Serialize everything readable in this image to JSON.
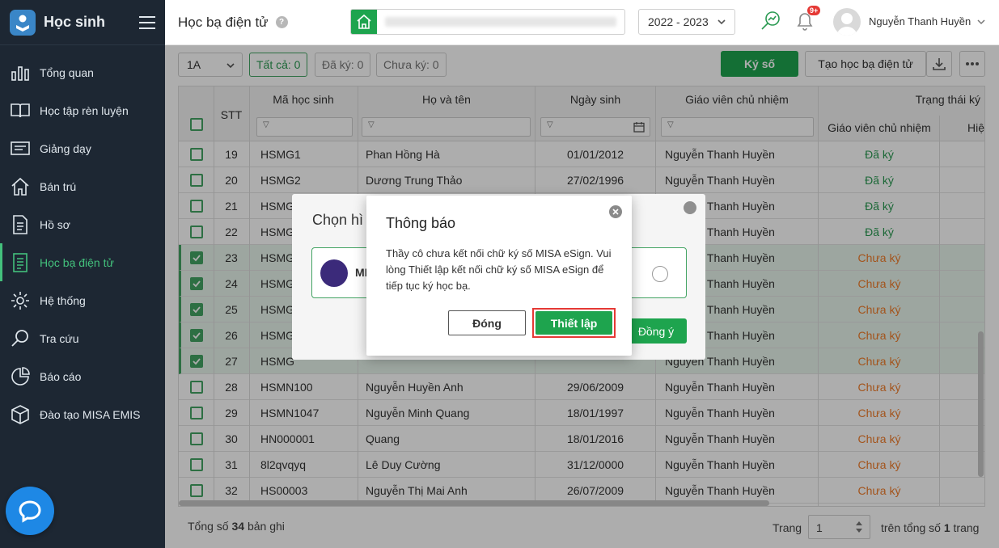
{
  "sidebar": {
    "title": "Học sinh",
    "items": [
      {
        "label": "Tổng quan"
      },
      {
        "label": "Học tập rèn luyện"
      },
      {
        "label": "Giảng dạy"
      },
      {
        "label": "Bán trú"
      },
      {
        "label": "Hồ sơ"
      },
      {
        "label": "Học bạ điện tử"
      },
      {
        "label": "Hệ thống"
      },
      {
        "label": "Tra cứu"
      },
      {
        "label": "Báo cáo"
      },
      {
        "label": "Đào tạo MISA EMIS"
      }
    ],
    "active_index": 5
  },
  "header": {
    "page_title": "Học bạ điện tử",
    "help": "?",
    "school_year": "2022 - 2023",
    "notification_badge": "9+",
    "user_name": "Nguyễn Thanh Huyền"
  },
  "toolbar": {
    "class_value": "1A",
    "filters": [
      "Tất cả: 0",
      "Đã ký: 0",
      "Chưa ký: 0"
    ],
    "sign_button": "Ký số",
    "create_button": "Tạo học bạ điện tử"
  },
  "table": {
    "columns": {
      "stt": "STT",
      "code": "Mã học sinh",
      "name": "Họ và tên",
      "dob": "Ngày sinh",
      "teacher": "Giáo viên chủ nhiệm",
      "status_group": "Trạng thái ký",
      "status_teacher": "Giáo viên chủ nhiệm",
      "status_principal": "Hiệ"
    },
    "rows": [
      {
        "stt": "19",
        "code": "HSMG1",
        "name": "Phan Hồng Hà",
        "dob": "01/01/2012",
        "teacher": "Nguyễn Thanh Huyền",
        "status": "Đã ký"
      },
      {
        "stt": "20",
        "code": "HSMG2",
        "name": "Dương Trung Thảo",
        "dob": "27/02/1996",
        "teacher": "Nguyễn Thanh Huyền",
        "status": "Đã ký"
      },
      {
        "stt": "21",
        "code": "HSMG",
        "name": "",
        "dob": "",
        "teacher": "Nguyễn Thanh Huyền",
        "status": "Đã ký"
      },
      {
        "stt": "22",
        "code": "HSMG",
        "name": "",
        "dob": "",
        "teacher": "Nguyễn Thanh Huyền",
        "status": "Đã ký"
      },
      {
        "stt": "23",
        "code": "HSMG",
        "name": "",
        "dob": "",
        "teacher": "Nguyễn Thanh Huyền",
        "status": "Chưa ký"
      },
      {
        "stt": "24",
        "code": "HSMG",
        "name": "",
        "dob": "",
        "teacher": "Nguyễn Thanh Huyền",
        "status": "Chưa ký"
      },
      {
        "stt": "25",
        "code": "HSMG",
        "name": "",
        "dob": "",
        "teacher": "Nguyễn Thanh Huyền",
        "status": "Chưa ký"
      },
      {
        "stt": "26",
        "code": "HSMG",
        "name": "",
        "dob": "",
        "teacher": "Nguyễn Thanh Huyền",
        "status": "Chưa ký"
      },
      {
        "stt": "27",
        "code": "HSMG",
        "name": "",
        "dob": "",
        "teacher": "Nguyễn Thanh Huyền",
        "status": "Chưa ký"
      },
      {
        "stt": "28",
        "code": "HSMN100",
        "name": "Nguyễn Huyền Anh",
        "dob": "29/06/2009",
        "teacher": "Nguyễn Thanh Huyền",
        "status": "Chưa ký"
      },
      {
        "stt": "29",
        "code": "HSMN1047",
        "name": "Nguyễn Minh Quang",
        "dob": "18/01/1997",
        "teacher": "Nguyễn Thanh Huyền",
        "status": "Chưa ký"
      },
      {
        "stt": "30",
        "code": "HN000001",
        "name": "Quang",
        "dob": "18/01/2016",
        "teacher": "Nguyễn Thanh Huyền",
        "status": "Chưa ký"
      },
      {
        "stt": "31",
        "code": "8l2qvqyq",
        "name": "Lê Duy Cường",
        "dob": "31/12/0000",
        "teacher": "Nguyễn Thanh Huyền",
        "status": "Chưa ký"
      },
      {
        "stt": "32",
        "code": "HS00003",
        "name": "Nguyễn Thị Mai Anh",
        "dob": "26/07/2009",
        "teacher": "Nguyễn Thanh Huyền",
        "status": "Chưa ký"
      }
    ]
  },
  "footer": {
    "total_prefix": "Tổng số",
    "total_count": "34",
    "total_suffix": "bản ghi",
    "page_label": "Trang",
    "page_value": "1",
    "pages_prefix": "trên tổng số",
    "pages_count": "1",
    "pages_suffix": "trang"
  },
  "background_dialog": {
    "title": "Chọn hì",
    "provider": "MI",
    "confirm": "Đồng ý"
  },
  "modal": {
    "title": "Thông báo",
    "message": "Thầy cô chưa kết nối chữ ký số MISA eSign. Vui lòng Thiết lập kết nối chữ ký số MISA eSign để tiếp tục ký học bạ.",
    "close_button": "Đóng",
    "setup_button": "Thiết lập"
  },
  "colors": {
    "sidebar_bg": "#1d2733",
    "accent_green": "#1ea44e",
    "signed": "#2a9a52",
    "unsigned": "#f07c2a",
    "highlight_border": "#e53935"
  }
}
